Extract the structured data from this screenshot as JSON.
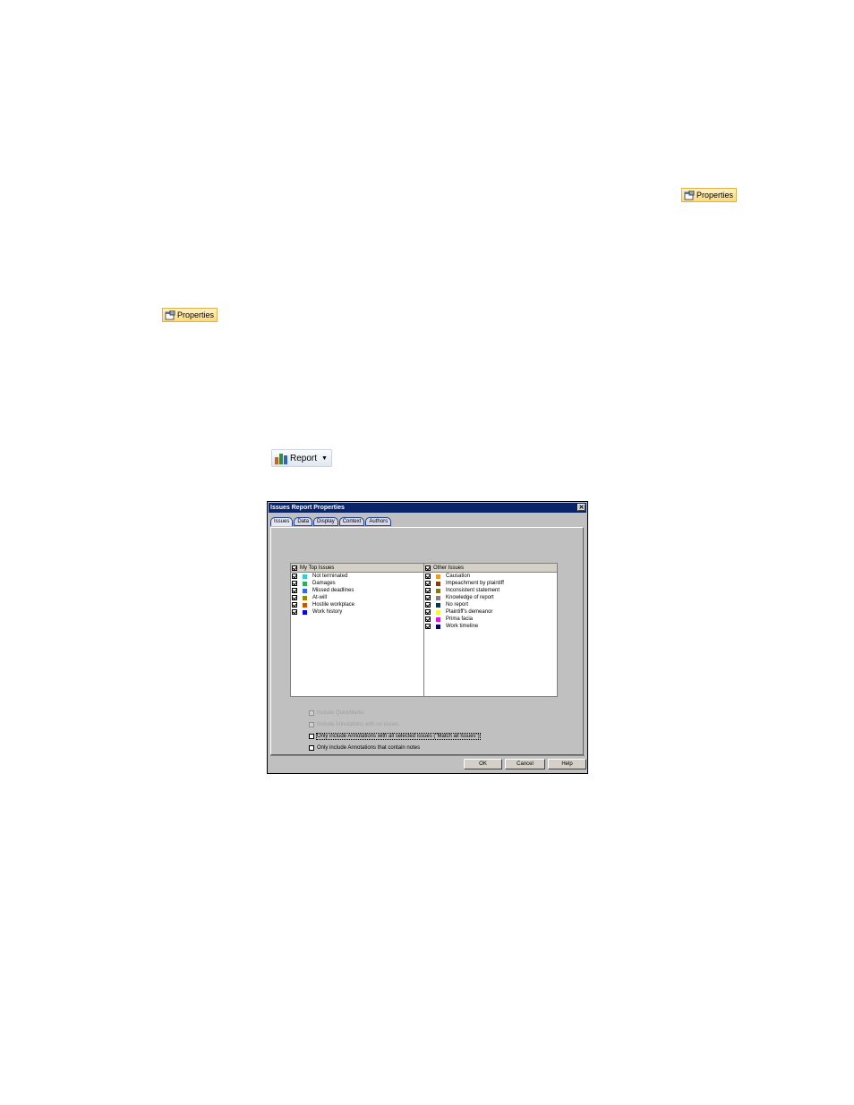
{
  "toolbar_buttons": {
    "properties_label": "Properties",
    "report_label": "Report"
  },
  "dialog": {
    "title": "Issues Report Properties",
    "close": "✕",
    "tabs": [
      "Issues",
      "Data",
      "Display",
      "Context",
      "Authors"
    ],
    "active_tab": "Issues",
    "my_top_issues": {
      "header": "My Top Issues",
      "items": [
        {
          "label": "Not terminated",
          "color": "#33cccc"
        },
        {
          "label": "Damages",
          "color": "#33aa55"
        },
        {
          "label": "Missed deadlines",
          "color": "#3366ff"
        },
        {
          "label": "At-will",
          "color": "#998800"
        },
        {
          "label": "Hostile workplace",
          "color": "#cc5500"
        },
        {
          "label": "Work history",
          "color": "#0000ff"
        }
      ]
    },
    "other_issues": {
      "header": "Other Issues",
      "items": [
        {
          "label": "Causation",
          "color": "#ff9900"
        },
        {
          "label": "Impeachment by plaintiff",
          "color": "#993300"
        },
        {
          "label": "Inconsistent statement",
          "color": "#808000"
        },
        {
          "label": "Knowledge of report",
          "color": "#808080"
        },
        {
          "label": "No report",
          "color": "#003366"
        },
        {
          "label": "Plaintiff's demeanor",
          "color": "#ffff00"
        },
        {
          "label": "Prima facia",
          "color": "#ff00ff"
        },
        {
          "label": "Work timeline",
          "color": "#000080"
        }
      ]
    },
    "options": [
      {
        "label": "Include QuickMarks",
        "checked": false,
        "disabled": true
      },
      {
        "label": "Include Annotations with no issues",
        "checked": false,
        "disabled": true
      },
      {
        "label": "Only include Annotations with all selected issues (\"Match all Issues\")",
        "checked": false,
        "disabled": false
      },
      {
        "label": "Only include Annotations that contain notes",
        "checked": false,
        "disabled": false
      }
    ],
    "buttons": {
      "ok": "OK",
      "cancel": "Cancel",
      "help": "Help"
    }
  }
}
